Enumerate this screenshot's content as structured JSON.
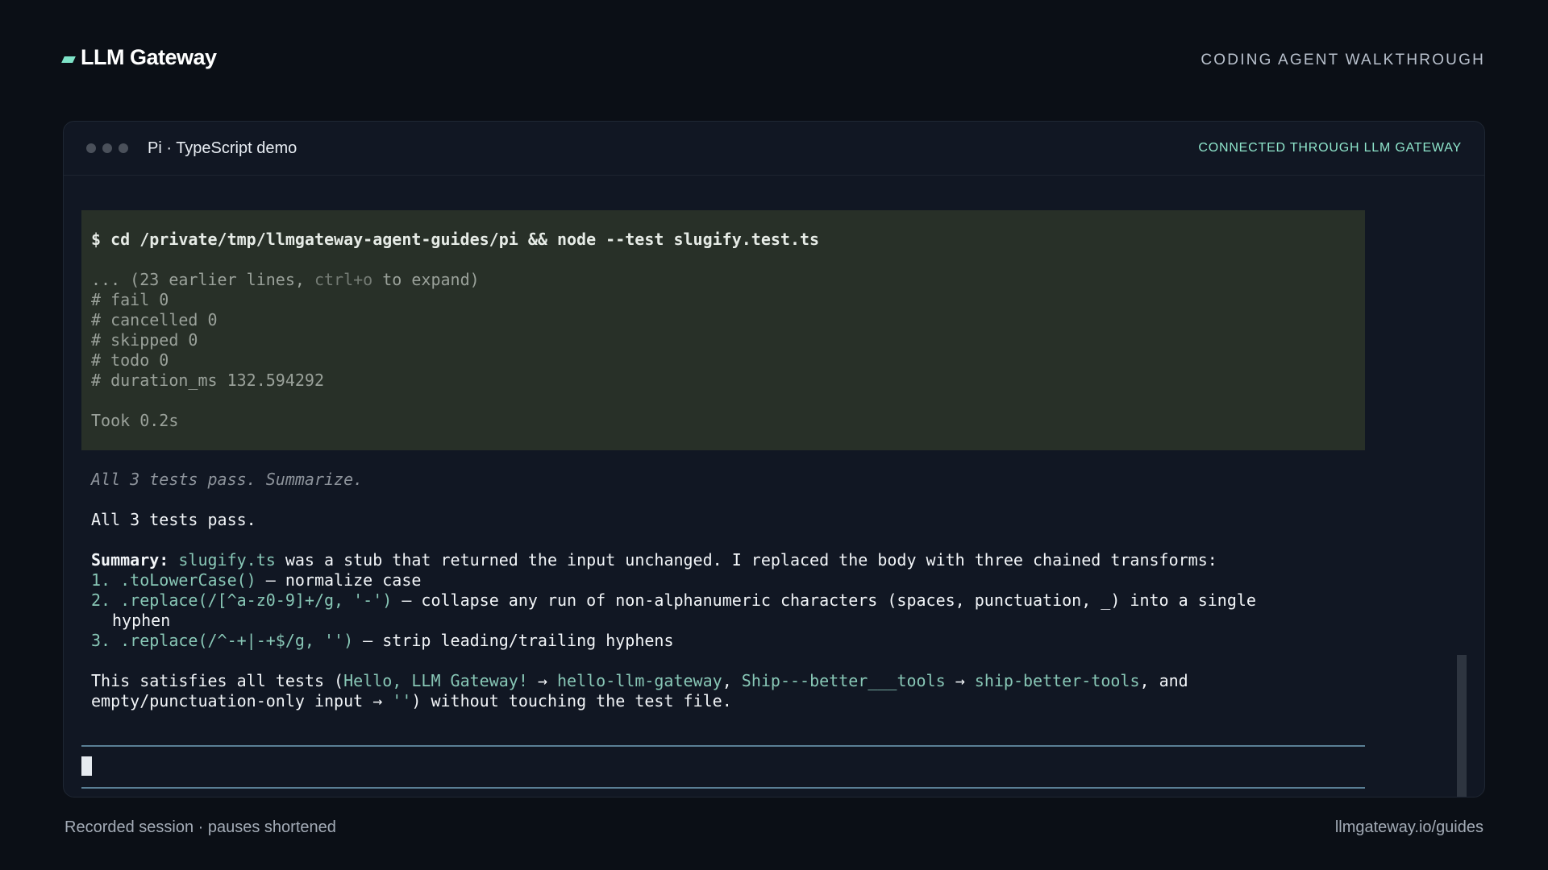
{
  "header": {
    "brand": "LLM Gateway",
    "walkthrough_label": "CODING AGENT WALKTHROUGH"
  },
  "window": {
    "title": "Pi · TypeScript demo",
    "status": "CONNECTED THROUGH LLM GATEWAY"
  },
  "terminal": {
    "command": "$ cd /private/tmp/llmgateway-agent-guides/pi && node --test slugify.test.ts",
    "earlier_prefix": "... (23 earlier lines, ",
    "earlier_key": "ctrl+o",
    "earlier_suffix": " to expand)",
    "output_lines": [
      "# fail 0",
      "# cancelled 0",
      "# skipped 0",
      "# todo 0",
      "# duration_ms 132.594292"
    ],
    "took": "Took 0.2s",
    "thinking": "All 3 tests pass. Summarize.",
    "response_head": "All 3 tests pass.",
    "summary_label": "Summary:",
    "summary_file": "slugify.ts",
    "summary_text": " was a stub that returned the input unchanged. I replaced the body with three chained transforms:",
    "steps": [
      {
        "num": "1.",
        "code": ".toLowerCase()",
        "text": " — normalize case",
        "cont": ""
      },
      {
        "num": "2.",
        "code": ".replace(/[^a-z0-9]+/g, '-')",
        "text": " — collapse any run of non-alphanumeric characters (spaces, punctuation, _) into a single",
        "cont": "hyphen"
      },
      {
        "num": "3.",
        "code": ".replace(/^-+|-+$/g, '')",
        "text": " — strip leading/trailing hyphens",
        "cont": ""
      }
    ],
    "conclusion": {
      "p1": "This satisfies all tests (",
      "c1": "Hello, LLM Gateway!",
      "arrow1": " → ",
      "c2": "hello-llm-gateway",
      "sep1": ", ",
      "c3": "Ship---better___tools",
      "arrow2": " → ",
      "c4": "ship-better-tools",
      "sep2": ", and",
      "line2a": "empty/punctuation-only input → ",
      "c5": "''",
      "line2b": ") without touching the test file."
    }
  },
  "footer": {
    "left": "Recorded session · pauses shortened",
    "right": "llmgateway.io/guides"
  }
}
